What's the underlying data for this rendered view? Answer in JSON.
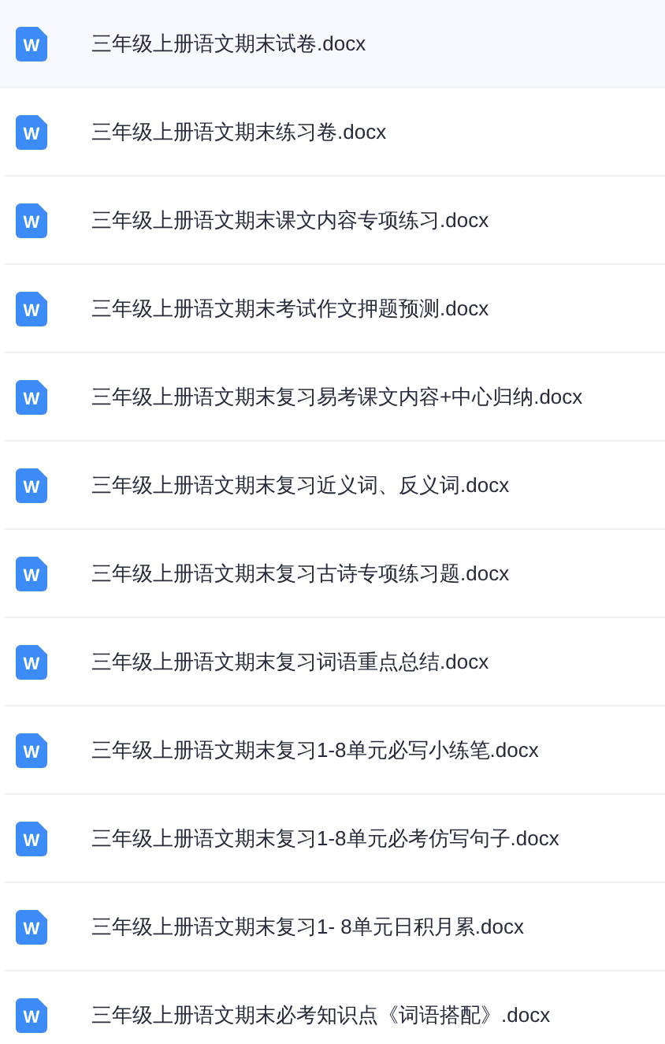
{
  "files": [
    {
      "name": "三年级上册语文期末试卷.docx",
      "icon_letter": "W",
      "selected": true
    },
    {
      "name": "三年级上册语文期末练习卷.docx",
      "icon_letter": "W",
      "selected": false
    },
    {
      "name": "三年级上册语文期末课文内容专项练习.docx",
      "icon_letter": "W",
      "selected": false
    },
    {
      "name": "三年级上册语文期末考试作文押题预测.docx",
      "icon_letter": "W",
      "selected": false
    },
    {
      "name": "三年级上册语文期末复习易考课文内容+中心归纳.docx",
      "icon_letter": "W",
      "selected": false
    },
    {
      "name": "三年级上册语文期末复习近义词、反义词.docx",
      "icon_letter": "W",
      "selected": false
    },
    {
      "name": "三年级上册语文期末复习古诗专项练习题.docx",
      "icon_letter": "W",
      "selected": false
    },
    {
      "name": "三年级上册语文期末复习词语重点总结.docx",
      "icon_letter": "W",
      "selected": false
    },
    {
      "name": "三年级上册语文期末复习1-8单元必写小练笔.docx",
      "icon_letter": "W",
      "selected": false
    },
    {
      "name": "三年级上册语文期末复习1-8单元必考仿写句子.docx",
      "icon_letter": "W",
      "selected": false
    },
    {
      "name": "三年级上册语文期末复习1- 8单元日积月累.docx",
      "icon_letter": "W",
      "selected": false
    },
    {
      "name": "三年级上册语文期末必考知识点《词语搭配》.docx",
      "icon_letter": "W",
      "selected": false
    }
  ]
}
